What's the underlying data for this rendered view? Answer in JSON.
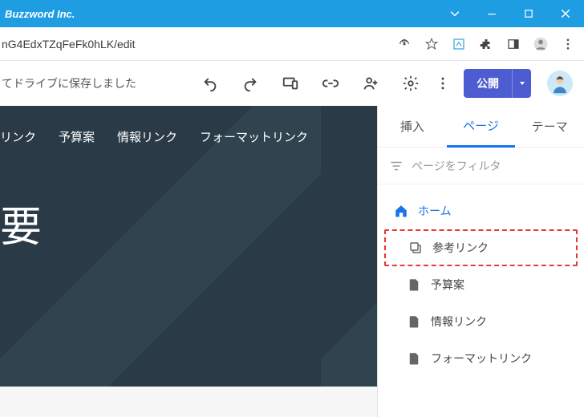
{
  "window": {
    "title": "Buzzword Inc."
  },
  "address": {
    "url": "nG4EdxTZqFeFk0hLK/edit"
  },
  "docbar": {
    "status": "てドライブに保存しました",
    "publish": "公開"
  },
  "hero": {
    "nav": [
      "リンク",
      "予算案",
      "情報リンク",
      "フォーマットリンク"
    ],
    "title": "要"
  },
  "sidebar": {
    "tabs": {
      "insert": "挿入",
      "pages": "ページ",
      "theme": "テーマ"
    },
    "filter_placeholder": "ページをフィルタ",
    "items": {
      "home": "ホーム",
      "ref": "参考リンク",
      "budget": "予算案",
      "info": "情報リンク",
      "format": "フォーマットリンク"
    }
  }
}
